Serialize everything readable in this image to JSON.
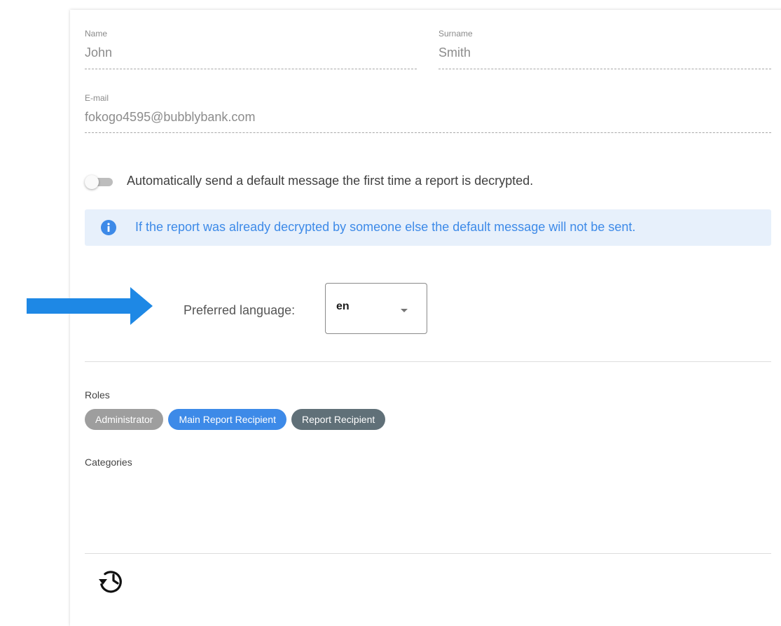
{
  "profile": {
    "name_label": "Name",
    "name_value": "John",
    "surname_label": "Surname",
    "surname_value": "Smith",
    "email_label": "E-mail",
    "email_value": "fokogo4595@bubblybank.com"
  },
  "auto_message": {
    "label": "Automatically send a default message the first time a report is decrypted.",
    "enabled": false
  },
  "info_alert": {
    "icon": "info-icon",
    "text": "If the report was already decrypted by someone else the default message will not be sent."
  },
  "preferred_language": {
    "label": "Preferred language:",
    "value": "en"
  },
  "roles": {
    "label": "Roles",
    "chips": [
      {
        "label": "Administrator",
        "color": "#9e9e9e"
      },
      {
        "label": "Main Report Recipient",
        "color": "#3d8ae8"
      },
      {
        "label": "Report Recipient",
        "color": "#607078"
      }
    ]
  },
  "categories": {
    "label": "Categories"
  },
  "footer": {
    "history_icon": "history-icon"
  },
  "colors": {
    "accent": "#3d8ae8",
    "arrow": "#1e88e5",
    "alert_bg": "#e7f0fb"
  }
}
